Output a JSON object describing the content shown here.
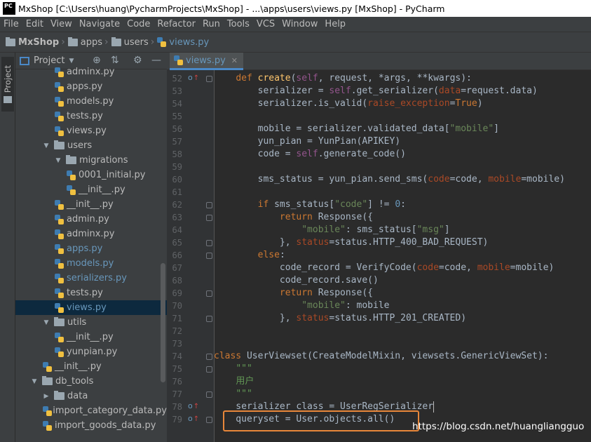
{
  "window": {
    "title": "MxShop [C:\\Users\\huang\\PycharmProjects\\MxShop] - ...\\apps\\users\\views.py [MxShop] - PyCharm",
    "logo": "PC"
  },
  "menu": [
    "File",
    "Edit",
    "View",
    "Navigate",
    "Code",
    "Refactor",
    "Run",
    "Tools",
    "VCS",
    "Window",
    "Help"
  ],
  "breadcrumb": [
    "MxShop",
    "apps",
    "users",
    "views.py"
  ],
  "sidebar_tab": "1: Project",
  "project_panel": {
    "title": "Project",
    "tree": [
      {
        "label": "adminx.py",
        "indent": 2,
        "kind": "py"
      },
      {
        "label": "apps.py",
        "indent": 2,
        "kind": "py"
      },
      {
        "label": "models.py",
        "indent": 2,
        "kind": "py"
      },
      {
        "label": "tests.py",
        "indent": 2,
        "kind": "py"
      },
      {
        "label": "views.py",
        "indent": 2,
        "kind": "py"
      },
      {
        "label": "users",
        "indent": 1,
        "kind": "dir",
        "expanded": true
      },
      {
        "label": "migrations",
        "indent": 2,
        "kind": "dir",
        "expanded": true
      },
      {
        "label": "0001_initial.py",
        "indent": 3,
        "kind": "py"
      },
      {
        "label": "__init__.py",
        "indent": 3,
        "kind": "py"
      },
      {
        "label": "__init__.py",
        "indent": 2,
        "kind": "py"
      },
      {
        "label": "admin.py",
        "indent": 2,
        "kind": "py"
      },
      {
        "label": "adminx.py",
        "indent": 2,
        "kind": "py"
      },
      {
        "label": "apps.py",
        "indent": 2,
        "kind": "py",
        "modified": true
      },
      {
        "label": "models.py",
        "indent": 2,
        "kind": "py",
        "modified": true
      },
      {
        "label": "serializers.py",
        "indent": 2,
        "kind": "py",
        "modified": true
      },
      {
        "label": "tests.py",
        "indent": 2,
        "kind": "py"
      },
      {
        "label": "views.py",
        "indent": 2,
        "kind": "py",
        "modified": true,
        "selected": true
      },
      {
        "label": "utils",
        "indent": 1,
        "kind": "dir",
        "expanded": true
      },
      {
        "label": "__init__.py",
        "indent": 2,
        "kind": "py"
      },
      {
        "label": "yunpian.py",
        "indent": 2,
        "kind": "py"
      },
      {
        "label": "__init__.py",
        "indent": 1,
        "kind": "py"
      },
      {
        "label": "db_tools",
        "indent": 0,
        "kind": "dir",
        "expanded": true
      },
      {
        "label": "data",
        "indent": 1,
        "kind": "dir",
        "expanded": false
      },
      {
        "label": "import_category_data.py",
        "indent": 1,
        "kind": "py"
      },
      {
        "label": "import_goods_data.py",
        "indent": 1,
        "kind": "py"
      }
    ]
  },
  "editor": {
    "tab_label": "views.py",
    "lines": [
      {
        "n": "52",
        "mark": "o↑",
        "fold": true,
        "html": "    <span class='kw'>def</span> <span class='fn'>create</span>(<span class='self'>self</span>, request, *args, **kwargs):"
      },
      {
        "n": "53",
        "html": "        serializer = <span class='self'>self</span>.get_serializer(<span class='param'>data</span>=request.data)"
      },
      {
        "n": "54",
        "html": "        serializer.is_valid(<span class='param'>raise_exception</span>=<span class='kw'>True</span>)"
      },
      {
        "n": "55",
        "html": ""
      },
      {
        "n": "56",
        "html": "        mobile = serializer.validated_data[<span class='str'>\"mobile\"</span>]"
      },
      {
        "n": "57",
        "html": "        yun_pian = YunPian(APIKEY)"
      },
      {
        "n": "58",
        "html": "        code = <span class='self'>self</span>.generate_code()"
      },
      {
        "n": "59",
        "html": ""
      },
      {
        "n": "60",
        "html": "        sms_status = yun_pian.send_sms(<span class='param'>code</span>=code, <span class='param'>mobile</span>=mobile)"
      },
      {
        "n": "61",
        "html": ""
      },
      {
        "n": "62",
        "fold": true,
        "html": "        <span class='kw'>if</span> sms_status[<span class='str'>\"code\"</span>] != <span class='num'>0</span>:"
      },
      {
        "n": "63",
        "fold": true,
        "html": "            <span class='kw'>return</span> Response({"
      },
      {
        "n": "64",
        "html": "                <span class='str'>\"mobile\"</span>: sms_status[<span class='str'>\"msg\"</span>]"
      },
      {
        "n": "65",
        "fold": true,
        "html": "            }, <span class='param'>status</span>=status.HTTP_400_BAD_REQUEST)"
      },
      {
        "n": "66",
        "fold": true,
        "html": "        <span class='kw'>else</span>:"
      },
      {
        "n": "67",
        "html": "            code_record = VerifyCode(<span class='param'>code</span>=code, <span class='param'>mobile</span>=mobile)"
      },
      {
        "n": "68",
        "html": "            code_record.save()"
      },
      {
        "n": "69",
        "fold": true,
        "html": "            <span class='kw'>return</span> Response({"
      },
      {
        "n": "70",
        "html": "                <span class='str'>\"mobile\"</span>: mobile"
      },
      {
        "n": "71",
        "fold": true,
        "html": "            }, <span class='param'>status</span>=status.HTTP_201_CREATED)"
      },
      {
        "n": "72",
        "html": ""
      },
      {
        "n": "73",
        "html": ""
      },
      {
        "n": "74",
        "fold": true,
        "html": "<span class='kw'>class</span> <span class='cls'>UserViewset</span>(CreateModelMixin, viewsets.GenericViewSet):"
      },
      {
        "n": "75",
        "fold": true,
        "html": "    <span class='doc'>\"\"\"</span>"
      },
      {
        "n": "76",
        "html": "    <span class='doc'>用户</span>"
      },
      {
        "n": "77",
        "fold": true,
        "html": "    <span class='doc'>\"\"\"</span>"
      },
      {
        "n": "78",
        "mark": "o↑",
        "html": "    serializer_class = UserRegSerializer<span class='cursor'></span>"
      },
      {
        "n": "79",
        "mark": "o↑",
        "fold": true,
        "html": "    queryset = User.objects.all()"
      }
    ]
  },
  "watermark": "https://blog.csdn.net/huangliangguo"
}
